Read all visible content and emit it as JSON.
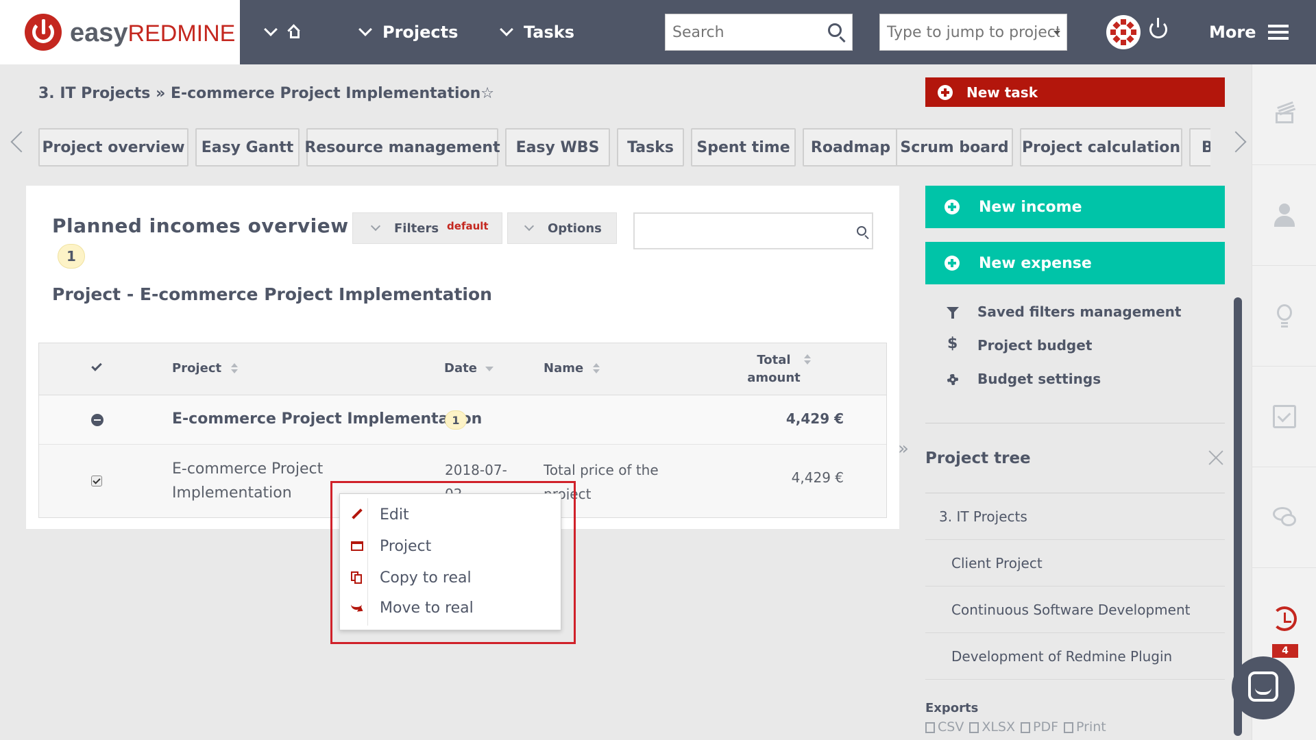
{
  "topbar": {
    "logo_easy": "easy",
    "logo_redmine": "REDMINE",
    "nav_projects": "Projects",
    "nav_tasks": "Tasks",
    "search_placeholder": "Search",
    "jump_placeholder": "Type to jump to project",
    "more_label": "More"
  },
  "breadcrumb": {
    "parent": "3. IT Projects",
    "separator": "»",
    "current": "E-commerce Project Implementation",
    "star": "☆"
  },
  "new_task_label": "New task",
  "tabs": [
    "Project overview",
    "Easy Gantt",
    "Resource management",
    "Easy WBS",
    "Tasks",
    "Spent time",
    "Roadmap",
    "Scrum board",
    "Project calculation",
    "B"
  ],
  "panel": {
    "title": "Planned incomes overview",
    "count": "1",
    "filters_label": "Filters",
    "filters_default": "default",
    "options_label": "Options",
    "subtitle": "Project - E-commerce Project Implementation"
  },
  "table": {
    "columns": {
      "project": "Project",
      "date": "Date",
      "name": "Name",
      "total_line1": "Total",
      "total_line2": "amount"
    },
    "group": {
      "name": "E-commerce Project Implementation",
      "count": "1",
      "total": "4,429 €"
    },
    "rows": [
      {
        "project_line1": "E-commerce Project",
        "project_line2": "Implementation",
        "date_line1": "2018-07-",
        "date_line2": "02",
        "name_line1": "Total price of the",
        "name_line2": "project",
        "total": "4,429 €"
      }
    ]
  },
  "context_menu": {
    "items": [
      "Edit",
      "Project",
      "Copy to real",
      "Move to real"
    ]
  },
  "sidebar": {
    "new_income": "New income",
    "new_expense": "New expense",
    "links": [
      "Saved filters management",
      "Project budget",
      "Budget settings"
    ],
    "tree_title": "Project tree",
    "tree_items": [
      "3. IT Projects",
      "Client Project",
      "Continuous Software Development",
      "Development of Redmine Plugin"
    ],
    "exports_title": "Exports",
    "exports": [
      "CSV",
      "XLSX",
      "PDF",
      "Print"
    ]
  },
  "history_badge": "4",
  "collapse_label": "»",
  "colors": {
    "topbar": "#4f5667",
    "brand_red": "#c4271f",
    "new_task": "#b3160c",
    "teal": "#00c4a8",
    "highlight": "#d0212a"
  }
}
